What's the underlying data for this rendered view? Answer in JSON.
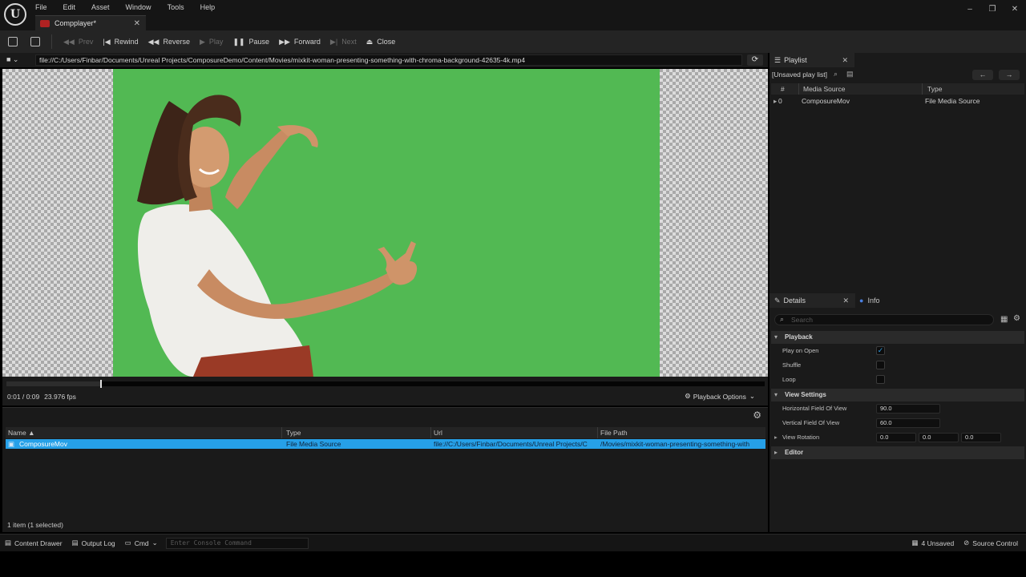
{
  "menu": [
    "File",
    "Edit",
    "Asset",
    "Window",
    "Tools",
    "Help"
  ],
  "doc_tab": {
    "label": "Compplayer*"
  },
  "window_controls": {
    "minimize": "–",
    "maximize": "❐",
    "close": "✕"
  },
  "toolbar": {
    "prev": "Prev",
    "rewind": "Rewind",
    "reverse": "Reverse",
    "play": "Play",
    "pause": "Pause",
    "forward": "Forward",
    "next": "Next",
    "close": "Close"
  },
  "url": "file://C:/Users/Finbar/Documents/Unreal Projects/ComposureDemo/Content/Movies/mixkit-woman-presenting-something-with-chroma-background-42635-4k.mp4",
  "playback": {
    "time": "0:01 / 0:09",
    "fps": "23.976 fps",
    "progress": 0.125,
    "options_label": "Playback Options"
  },
  "media_list": {
    "columns": [
      "Name",
      "Type",
      "Url",
      "File Path"
    ],
    "sort_indicator": "▲",
    "rows": [
      {
        "name": "ComposureMov",
        "type": "File Media Source",
        "url": "file://C:/Users/Finbar/Documents/Unreal Projects/C",
        "file_path": "/Movies/mixkit-woman-presenting-something-with"
      }
    ],
    "count": "1 item (1 selected)"
  },
  "playlist": {
    "tab_label": "Playlist",
    "name": "[Unsaved play list]",
    "columns": [
      "#",
      "Media Source",
      "Type"
    ],
    "rows": [
      {
        "index": "0",
        "source": "ComposureMov",
        "type": "File Media Source"
      }
    ]
  },
  "details": {
    "tab_label": "Details",
    "info_label": "Info",
    "search_placeholder": "Search",
    "categories": {
      "playback": "Playback",
      "view_settings": "View Settings",
      "editor": "Editor"
    },
    "props": {
      "play_on_open": {
        "label": "Play on Open",
        "checked": true
      },
      "shuffle": {
        "label": "Shuffle",
        "checked": false
      },
      "loop": {
        "label": "Loop",
        "checked": false
      },
      "hfov": {
        "label": "Horizontal Field Of View",
        "value": "90.0"
      },
      "vfov": {
        "label": "Vertical Field Of View",
        "value": "60.0"
      },
      "view_rotation": {
        "label": "View Rotation",
        "values": [
          "0.0",
          "0.0",
          "0.0"
        ]
      }
    }
  },
  "statusbar": {
    "content_drawer": "Content Drawer",
    "output_log": "Output Log",
    "cmd": "Cmd",
    "console_placeholder": "Enter Console Command",
    "unsaved": "4 Unsaved",
    "source_control": "Source Control"
  },
  "colors": {
    "chroma_green": "#52b953",
    "selection_blue": "#26a0e8",
    "panel_bg": "#1a1a1a"
  }
}
